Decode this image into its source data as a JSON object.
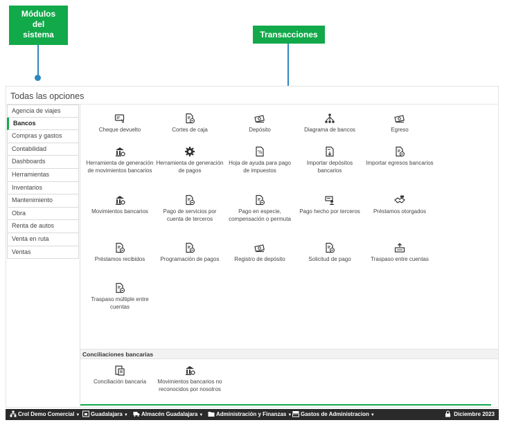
{
  "callouts": {
    "modules": [
      "Módulos",
      "del",
      "sistema"
    ],
    "transactions": "Transacciones"
  },
  "panel": {
    "title": "Todas las opciones"
  },
  "sidebar": {
    "items": [
      {
        "label": "Agencia de viajes"
      },
      {
        "label": "Bancos",
        "active": true
      },
      {
        "label": "Compras y gastos"
      },
      {
        "label": "Contabilidad"
      },
      {
        "label": "Dashboards"
      },
      {
        "label": "Herramientas"
      },
      {
        "label": "Inventarios"
      },
      {
        "label": "Mantenimiento"
      },
      {
        "label": "Obra"
      },
      {
        "label": "Renta de autos"
      },
      {
        "label": "Venta en ruta"
      },
      {
        "label": "Ventas"
      }
    ]
  },
  "transactions": [
    {
      "label": "Cheque devuelto",
      "icon": "check-returned-icon"
    },
    {
      "label": "Cortes de caja",
      "icon": "document-icon"
    },
    {
      "label": "Depósito",
      "icon": "money-icon"
    },
    {
      "label": "Diagrama de bancos",
      "icon": "diagram-icon"
    },
    {
      "label": "Egreso",
      "icon": "money-icon"
    },
    {
      "label": "Herramienta de generación de movimientos bancarios",
      "icon": "bank-tool-icon"
    },
    {
      "label": "Herramienta de generación de pagos",
      "icon": "gear-icon"
    },
    {
      "label": "Hoja de ayuda para pago de impuestos",
      "icon": "tax-sheet-icon"
    },
    {
      "label": "Importar depósitos bancarios",
      "icon": "import-icon"
    },
    {
      "label": "Importar egresos bancarios",
      "icon": "document-icon"
    },
    {
      "label": "Movimientos bancarios",
      "icon": "bank-tool-icon"
    },
    {
      "label": "Pago de servicios por cuenta de terceros",
      "icon": "document-icon"
    },
    {
      "label": "Pago en especie, compensación o permuta",
      "icon": "document-icon"
    },
    {
      "label": "Pago hecho por terceros",
      "icon": "payment-icon"
    },
    {
      "label": "Préstamos otorgados",
      "icon": "handshake-icon"
    },
    {
      "label": "Préstamos recibidos",
      "icon": "document-icon"
    },
    {
      "label": "Programación de pagos",
      "icon": "document-icon"
    },
    {
      "label": "Registro de depósito",
      "icon": "money-icon"
    },
    {
      "label": "Solicitud de pago",
      "icon": "document-icon"
    },
    {
      "label": "Traspaso entre cuentas",
      "icon": "transfer-icon"
    },
    {
      "label": "Traspaso múltiple entre cuentas",
      "icon": "document-icon"
    }
  ],
  "reconciliations": {
    "title": "Conciliaciones bancarias",
    "items": [
      {
        "label": "Conciliación bancaria",
        "icon": "bank-icon"
      },
      {
        "label": "Movimientos bancarios no reconocidos por nosotros",
        "icon": "bank-tool-icon"
      }
    ]
  },
  "bottombar": {
    "company": "Crol Demo Comercial",
    "branch": "Guadalajara",
    "warehouse": "Almacén Guadalajara",
    "department": "Administración y Finanzas",
    "expense": "Gastos de Administracion",
    "period": "Diciembre 2023"
  },
  "colors": {
    "accent": "#12a94a",
    "callout_line": "#2e86c1",
    "bottombar": "#2a2a2a"
  }
}
